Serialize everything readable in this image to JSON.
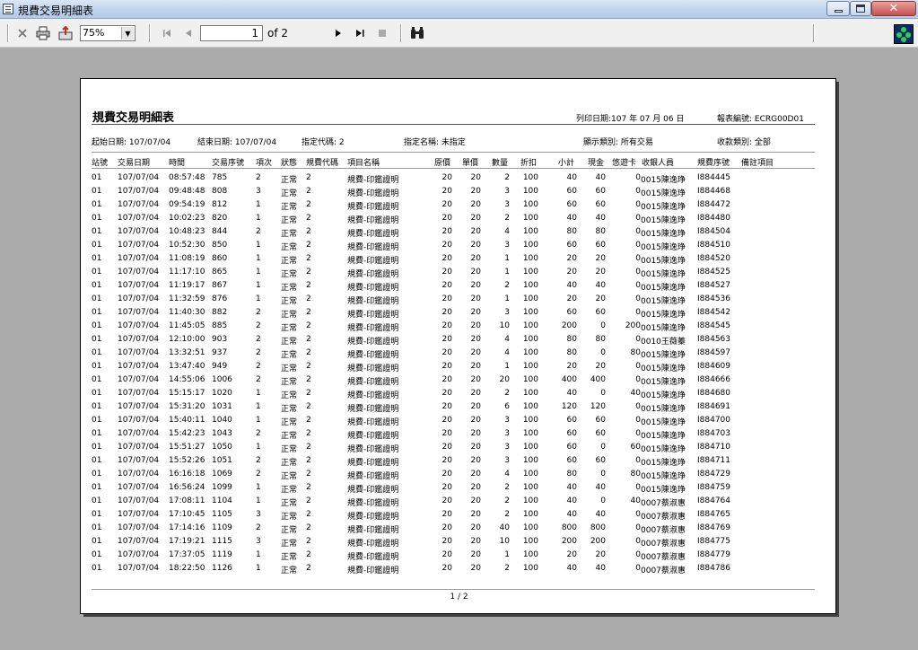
{
  "window": {
    "title": "規費交易明細表"
  },
  "toolbar": {
    "zoom": "75%",
    "current_page": "1",
    "page_total": "of 2"
  },
  "report": {
    "title": "規費交易明細表",
    "print_date": "列印日期:107 年 07 月 06 日",
    "report_code": "報表編號: ECRG00D01",
    "params": {
      "start_date": "起始日期:  107/07/04",
      "end_date": "結束日期:  107/07/04",
      "designated_code": "指定代碼:   2",
      "designated_name": "指定名稱:   未指定",
      "display_type": "顯示類別:   所有交易",
      "receipt_type": "收款類別:   全部"
    },
    "columns": [
      "站號",
      "交易日期",
      "時間",
      "交易序號",
      "項次",
      "狀態",
      "規費代碼",
      "項目名稱",
      "原價",
      "單價",
      "數量",
      "折扣",
      "小計",
      "現金",
      "悠遊卡",
      "收銀人員",
      "規費序號",
      "備註項目"
    ],
    "rows": [
      [
        "01",
        "107/07/04",
        "08:57:48",
        "785",
        "2",
        "正常",
        "2",
        "規費-印鑑證明",
        "20",
        "20",
        "2",
        "100",
        "40",
        "40",
        "0",
        "0015陳逸琤",
        "I884445"
      ],
      [
        "01",
        "107/07/04",
        "09:48:48",
        "808",
        "3",
        "正常",
        "2",
        "規費-印鑑證明",
        "20",
        "20",
        "3",
        "100",
        "60",
        "60",
        "0",
        "0015陳逸琤",
        "I884468"
      ],
      [
        "01",
        "107/07/04",
        "09:54:19",
        "812",
        "1",
        "正常",
        "2",
        "規費-印鑑證明",
        "20",
        "20",
        "3",
        "100",
        "60",
        "60",
        "0",
        "0015陳逸琤",
        "I884472"
      ],
      [
        "01",
        "107/07/04",
        "10:02:23",
        "820",
        "1",
        "正常",
        "2",
        "規費-印鑑證明",
        "20",
        "20",
        "2",
        "100",
        "40",
        "40",
        "0",
        "0015陳逸琤",
        "I884480"
      ],
      [
        "01",
        "107/07/04",
        "10:48:23",
        "844",
        "2",
        "正常",
        "2",
        "規費-印鑑證明",
        "20",
        "20",
        "4",
        "100",
        "80",
        "80",
        "0",
        "0015陳逸琤",
        "I884504"
      ],
      [
        "01",
        "107/07/04",
        "10:52:30",
        "850",
        "1",
        "正常",
        "2",
        "規費-印鑑證明",
        "20",
        "20",
        "3",
        "100",
        "60",
        "60",
        "0",
        "0015陳逸琤",
        "I884510"
      ],
      [
        "01",
        "107/07/04",
        "11:08:19",
        "860",
        "1",
        "正常",
        "2",
        "規費-印鑑證明",
        "20",
        "20",
        "1",
        "100",
        "20",
        "20",
        "0",
        "0015陳逸琤",
        "I884520"
      ],
      [
        "01",
        "107/07/04",
        "11:17:10",
        "865",
        "1",
        "正常",
        "2",
        "規費-印鑑證明",
        "20",
        "20",
        "1",
        "100",
        "20",
        "20",
        "0",
        "0015陳逸琤",
        "I884525"
      ],
      [
        "01",
        "107/07/04",
        "11:19:17",
        "867",
        "1",
        "正常",
        "2",
        "規費-印鑑證明",
        "20",
        "20",
        "2",
        "100",
        "40",
        "40",
        "0",
        "0015陳逸琤",
        "I884527"
      ],
      [
        "01",
        "107/07/04",
        "11:32:59",
        "876",
        "1",
        "正常",
        "2",
        "規費-印鑑證明",
        "20",
        "20",
        "1",
        "100",
        "20",
        "20",
        "0",
        "0015陳逸琤",
        "I884536"
      ],
      [
        "01",
        "107/07/04",
        "11:40:30",
        "882",
        "2",
        "正常",
        "2",
        "規費-印鑑證明",
        "20",
        "20",
        "3",
        "100",
        "60",
        "60",
        "0",
        "0015陳逸琤",
        "I884542"
      ],
      [
        "01",
        "107/07/04",
        "11:45:05",
        "885",
        "2",
        "正常",
        "2",
        "規費-印鑑證明",
        "20",
        "20",
        "10",
        "100",
        "200",
        "0",
        "200",
        "0015陳逸琤",
        "I884545"
      ],
      [
        "01",
        "107/07/04",
        "12:10:00",
        "903",
        "2",
        "正常",
        "2",
        "規費-印鑑證明",
        "20",
        "20",
        "4",
        "100",
        "80",
        "80",
        "0",
        "0010王薇蓁",
        "I884563"
      ],
      [
        "01",
        "107/07/04",
        "13:32:51",
        "937",
        "2",
        "正常",
        "2",
        "規費-印鑑證明",
        "20",
        "20",
        "4",
        "100",
        "80",
        "0",
        "80",
        "0015陳逸琤",
        "I884597"
      ],
      [
        "01",
        "107/07/04",
        "13:47:40",
        "949",
        "2",
        "正常",
        "2",
        "規費-印鑑證明",
        "20",
        "20",
        "1",
        "100",
        "20",
        "20",
        "0",
        "0015陳逸琤",
        "I884609"
      ],
      [
        "01",
        "107/07/04",
        "14:55:06",
        "1006",
        "2",
        "正常",
        "2",
        "規費-印鑑證明",
        "20",
        "20",
        "20",
        "100",
        "400",
        "400",
        "0",
        "0015陳逸琤",
        "I884666"
      ],
      [
        "01",
        "107/07/04",
        "15:15:17",
        "1020",
        "1",
        "正常",
        "2",
        "規費-印鑑證明",
        "20",
        "20",
        "2",
        "100",
        "40",
        "0",
        "40",
        "0015陳逸琤",
        "I884680"
      ],
      [
        "01",
        "107/07/04",
        "15:31:20",
        "1031",
        "1",
        "正常",
        "2",
        "規費-印鑑證明",
        "20",
        "20",
        "6",
        "100",
        "120",
        "120",
        "0",
        "0015陳逸琤",
        "I884691"
      ],
      [
        "01",
        "107/07/04",
        "15:40:11",
        "1040",
        "1",
        "正常",
        "2",
        "規費-印鑑證明",
        "20",
        "20",
        "3",
        "100",
        "60",
        "60",
        "0",
        "0015陳逸琤",
        "I884700"
      ],
      [
        "01",
        "107/07/04",
        "15:42:23",
        "1043",
        "2",
        "正常",
        "2",
        "規費-印鑑證明",
        "20",
        "20",
        "3",
        "100",
        "60",
        "60",
        "0",
        "0015陳逸琤",
        "I884703"
      ],
      [
        "01",
        "107/07/04",
        "15:51:27",
        "1050",
        "1",
        "正常",
        "2",
        "規費-印鑑證明",
        "20",
        "20",
        "3",
        "100",
        "60",
        "0",
        "60",
        "0015陳逸琤",
        "I884710"
      ],
      [
        "01",
        "107/07/04",
        "15:52:26",
        "1051",
        "2",
        "正常",
        "2",
        "規費-印鑑證明",
        "20",
        "20",
        "3",
        "100",
        "60",
        "60",
        "0",
        "0015陳逸琤",
        "I884711"
      ],
      [
        "01",
        "107/07/04",
        "16:16:18",
        "1069",
        "2",
        "正常",
        "2",
        "規費-印鑑證明",
        "20",
        "20",
        "4",
        "100",
        "80",
        "0",
        "80",
        "0015陳逸琤",
        "I884729"
      ],
      [
        "01",
        "107/07/04",
        "16:56:24",
        "1099",
        "1",
        "正常",
        "2",
        "規費-印鑑證明",
        "20",
        "20",
        "2",
        "100",
        "40",
        "40",
        "0",
        "0015陳逸琤",
        "I884759"
      ],
      [
        "01",
        "107/07/04",
        "17:08:11",
        "1104",
        "1",
        "正常",
        "2",
        "規費-印鑑證明",
        "20",
        "20",
        "2",
        "100",
        "40",
        "0",
        "40",
        "0007蔡淑惠",
        "I884764"
      ],
      [
        "01",
        "107/07/04",
        "17:10:45",
        "1105",
        "3",
        "正常",
        "2",
        "規費-印鑑證明",
        "20",
        "20",
        "2",
        "100",
        "40",
        "40",
        "0",
        "0007蔡淑惠",
        "I884765"
      ],
      [
        "01",
        "107/07/04",
        "17:14:16",
        "1109",
        "2",
        "正常",
        "2",
        "規費-印鑑證明",
        "20",
        "20",
        "40",
        "100",
        "800",
        "800",
        "0",
        "0007蔡淑惠",
        "I884769"
      ],
      [
        "01",
        "107/07/04",
        "17:19:21",
        "1115",
        "3",
        "正常",
        "2",
        "規費-印鑑證明",
        "20",
        "20",
        "10",
        "100",
        "200",
        "200",
        "0",
        "0007蔡淑惠",
        "I884775"
      ],
      [
        "01",
        "107/07/04",
        "17:37:05",
        "1119",
        "1",
        "正常",
        "2",
        "規費-印鑑證明",
        "20",
        "20",
        "1",
        "100",
        "20",
        "20",
        "0",
        "0007蔡淑惠",
        "I884779"
      ],
      [
        "01",
        "107/07/04",
        "18:22:50",
        "1126",
        "1",
        "正常",
        "2",
        "規費-印鑑證明",
        "20",
        "20",
        "2",
        "100",
        "40",
        "40",
        "0",
        "0007蔡淑惠",
        "I884786"
      ]
    ],
    "page_number": "1  /  2"
  }
}
